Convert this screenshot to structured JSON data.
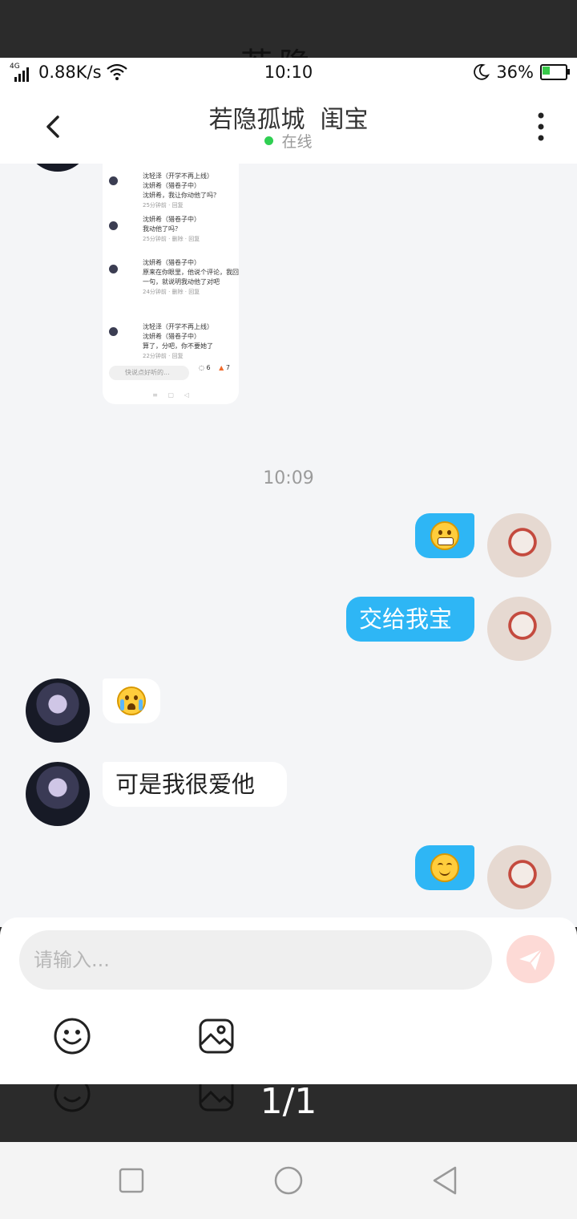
{
  "status_bar": {
    "network": "4G",
    "speed": "0.88K/s",
    "time": "10:10",
    "battery": "36%",
    "battery_level": 0.36
  },
  "header": {
    "title": "若隐孤城  闺宝",
    "status": "在线"
  },
  "screenshot_preview": {
    "comments": [
      {
        "name": "沈轻泽（开学不再上线）",
        "action": "回复",
        "text": "沈妍希（猎卷子中）\n沈妍希，我让你动他了吗？",
        "meta": "25分钟前 · 回复"
      },
      {
        "name": "沈妍希（猎卷子中）",
        "action": "回复沈轻泽（开学不再上线）",
        "text": "我动他了吗？",
        "meta": "25分钟前 · 删除 · 回复"
      },
      {
        "name": "沈妍希（猎卷子中）",
        "action": "回复沈轻泽（开学不再上线）",
        "text": "原来在你眼里，他说个评论，我回复一句，就说明我动他了对吧",
        "meta": "24分钟前 · 删除 · 回复"
      },
      {
        "name": "沈轻泽（开学不再上线）",
        "action": "回复",
        "text": "沈妍希（猎卷子中）\n算了，分吧，你不要她了",
        "meta": "22分钟前 · 回复"
      }
    ],
    "input_placeholder": "快说点好听的...",
    "comment_count": "6",
    "like_count": "7"
  },
  "timestamp": "10:09",
  "messages": [
    {
      "side": "out",
      "type": "emoji",
      "emoji": "grinning-face"
    },
    {
      "side": "out",
      "type": "text",
      "text": "交给我宝"
    },
    {
      "side": "in",
      "type": "emoji",
      "emoji": "crying-face"
    },
    {
      "side": "in",
      "type": "text",
      "text": "可是我很爱他"
    },
    {
      "side": "out",
      "type": "emoji",
      "emoji": "smiling-face"
    }
  ],
  "composer": {
    "placeholder": "请输入..."
  },
  "viewer": {
    "counter": "1/1"
  },
  "colors": {
    "outgoing_bubble": "#2eb6f5",
    "online_dot": "#2fcf52",
    "send_button": "#fddad6"
  }
}
